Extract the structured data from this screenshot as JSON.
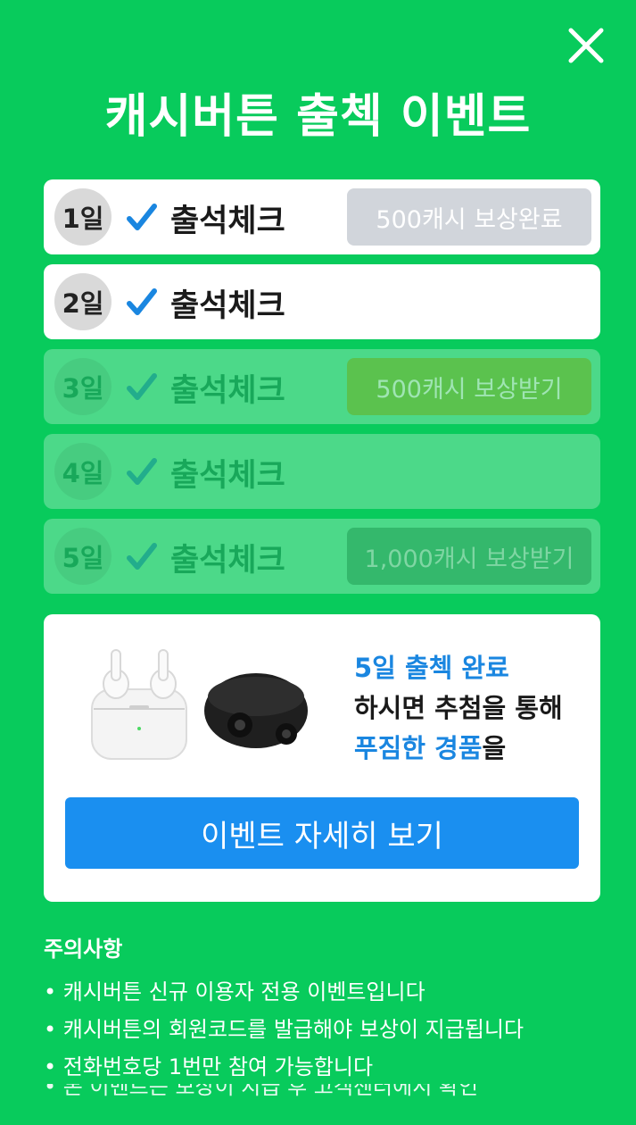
{
  "title": "캐시버튼 출첵 이벤트",
  "rows": [
    {
      "day": "1일",
      "label": "출석체크",
      "reward": "500캐시 보상완료"
    },
    {
      "day": "2일",
      "label": "출석체크",
      "reward": ""
    },
    {
      "day": "3일",
      "label": "출석체크",
      "reward": "500캐시 보상받기"
    },
    {
      "day": "4일",
      "label": "출석체크",
      "reward": ""
    },
    {
      "day": "5일",
      "label": "출석체크",
      "reward": "1,000캐시 보상받기"
    }
  ],
  "promo": {
    "line1": "5일 출첵 완료",
    "line2": "하시면 추첨을 통해",
    "line3_blue": "푸짐한 경품",
    "line3_rest": "을",
    "button": "이벤트 자세히 보기"
  },
  "notice": {
    "title": "주의사항",
    "items": [
      "캐시버튼 신규 이용자 전용 이벤트입니다",
      "캐시버튼의 회원코드를 발급해야 보상이 지급됩니다",
      "전화번호당 1번만 참여 가능합니다"
    ],
    "cut": "• 본 이벤트는 보상이 지급 후 고객센터에서 확인"
  },
  "colors": {
    "background": "#08cb5c",
    "button": "#1a8ff0",
    "accent_blue": "#1a86e0"
  }
}
